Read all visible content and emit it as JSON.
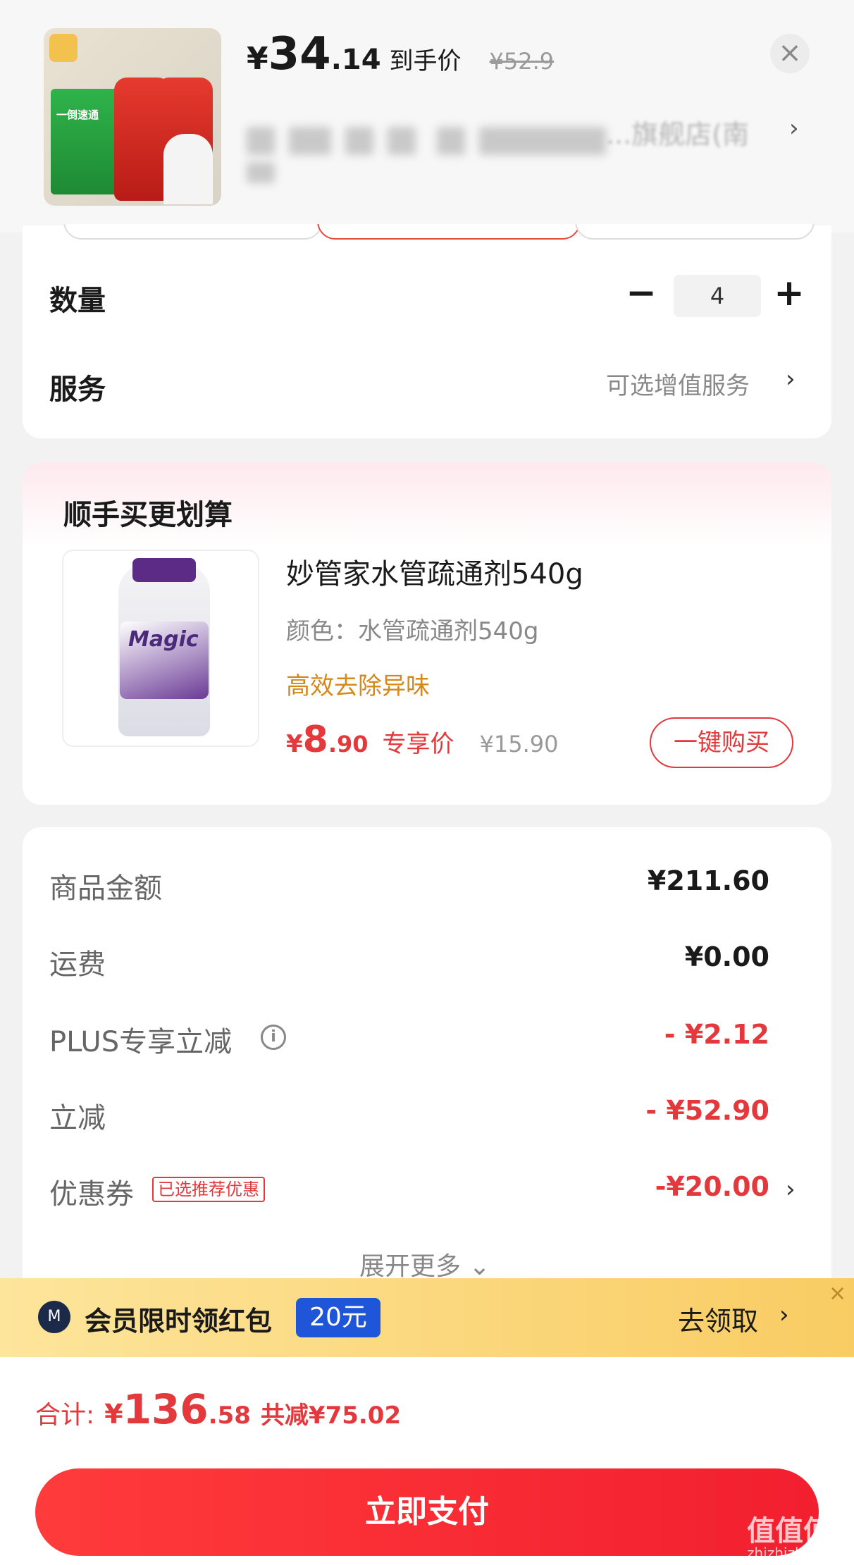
{
  "header": {
    "price_symbol": "¥",
    "price_integer": "34",
    "price_decimal": ".14",
    "price_tag": "到手价",
    "original_price": "¥52.9",
    "close_icon": "×",
    "shop_name": "...旗舰店(南",
    "shop_arrow": "›"
  },
  "selection": {
    "quantity_label": "数量",
    "quantity_minus": "−",
    "quantity_value": "4",
    "quantity_plus": "+",
    "service_label": "服务",
    "service_value": "可选增值服务",
    "service_arrow": "›"
  },
  "upsell": {
    "title": "顺手买更划算",
    "product_name": "妙管家水管疏通剂540g",
    "product_color": "颜色：水管疏通剂540g",
    "product_feature": "高效去除异味",
    "price_symbol": "¥",
    "price_integer": "8",
    "price_decimal": ".90",
    "price_tag": "专享价",
    "original_price": "¥15.90",
    "buy_button": "一键购买",
    "image_logo": "Magic"
  },
  "summary": {
    "rows": [
      {
        "label": "商品金额",
        "value": "¥211.60"
      },
      {
        "label": "运费",
        "value": "¥0.00"
      },
      {
        "label": "PLUS专享立减",
        "value": "- ¥2.12"
      },
      {
        "label": "立减",
        "value": "- ¥52.90"
      },
      {
        "label": "优惠券",
        "value": "-¥20.00"
      }
    ],
    "coupon_tag": "已选推荐优惠",
    "info_icon": "i",
    "arrow": "›",
    "expand": "展开更多 ⌄"
  },
  "banner": {
    "icon": "M",
    "text": "会员限时领红包",
    "pill": "20元",
    "cta": "去领取",
    "arrow": "›",
    "close": "×"
  },
  "footer": {
    "total_label": "合计:",
    "total_symbol": "¥",
    "total_integer": "136",
    "total_decimal": ".58",
    "total_saving": "共减¥75.02",
    "pay_button": "立即支付",
    "watermark": "值值值",
    "watermark_sub": "zhizhizhi.com"
  },
  "colors": {
    "accent_red": "#e4393c",
    "feature_orange": "#d4891a",
    "banner_yellow": "#f9cc63",
    "pill_blue": "#1f55d8"
  }
}
